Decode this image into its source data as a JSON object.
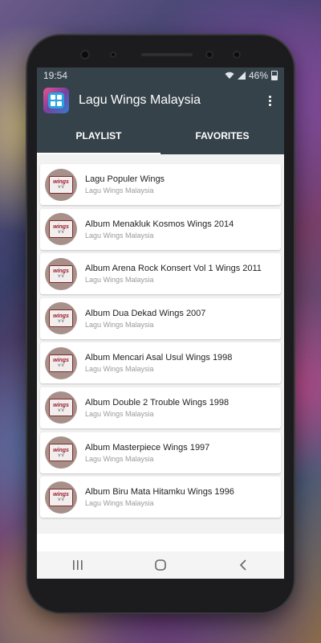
{
  "status_bar": {
    "time": "19:54",
    "battery": "46%",
    "icons": [
      "wifi-icon",
      "signal-icon",
      "battery-icon"
    ]
  },
  "app_bar": {
    "title": "Lagu Wings Malaysia",
    "icon": "app-grid-icon",
    "menu_icon": "more-vert-icon"
  },
  "tabs": [
    {
      "label": "PLAYLIST",
      "active": true
    },
    {
      "label": "FAVORITES",
      "active": false
    }
  ],
  "thumb": {
    "logo_text": "wings"
  },
  "playlist": [
    {
      "title": "Lagu Populer Wings",
      "subtitle": "Lagu Wings Malaysia"
    },
    {
      "title": "Album Menakluk Kosmos Wings 2014",
      "subtitle": "Lagu Wings Malaysia"
    },
    {
      "title": "Album Arena Rock Konsert Vol 1 Wings 2011",
      "subtitle": "Lagu Wings Malaysia"
    },
    {
      "title": "Album Dua Dekad Wings 2007",
      "subtitle": "Lagu Wings Malaysia"
    },
    {
      "title": "Album Mencari Asal Usul Wings 1998",
      "subtitle": "Lagu Wings Malaysia"
    },
    {
      "title": "Album Double 2 Trouble Wings 1998",
      "subtitle": "Lagu Wings Malaysia"
    },
    {
      "title": "Album Masterpiece Wings 1997",
      "subtitle": "Lagu Wings Malaysia"
    },
    {
      "title": "Album Biru Mata Hitamku Wings 1996",
      "subtitle": "Lagu Wings Malaysia"
    }
  ],
  "nav_bar": {
    "buttons": [
      "recents-icon",
      "home-icon",
      "back-icon"
    ]
  },
  "colors": {
    "toolbar": "#36424a",
    "list_bg": "#f2f2f2",
    "thumb_bg": "#a7908a"
  }
}
